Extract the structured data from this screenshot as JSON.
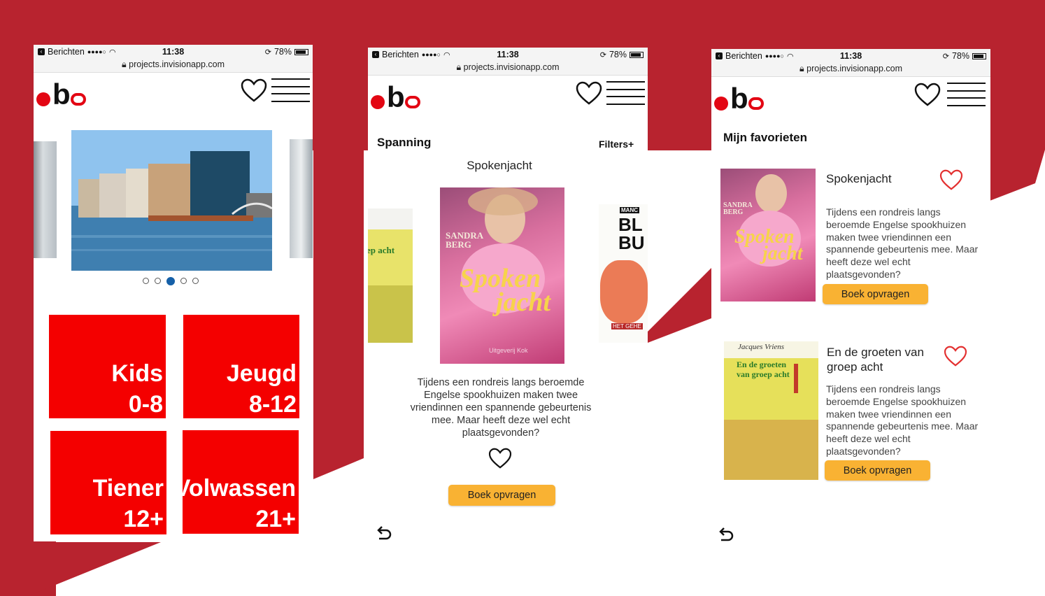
{
  "colors": {
    "background_red": "#b8232f",
    "tile_red": "#f40000",
    "accent_yellow": "#f9b233",
    "dot_active": "#1560a8",
    "heart_red": "#e33030"
  },
  "status_bar": {
    "carrier": "Berichten",
    "signal": "●●●●○",
    "time": "11:38",
    "battery": "78%"
  },
  "url": "projects.invisionapp.com",
  "logo": {
    "text": "ob"
  },
  "screen1": {
    "carousel_page": 3,
    "carousel_total": 5,
    "tiles": [
      {
        "line1": "Kids",
        "line2": "0-8"
      },
      {
        "line1": "Jeugd",
        "line2": "8-12"
      },
      {
        "line1": "Tiener",
        "line2": "12+"
      },
      {
        "line1": "Volwassen",
        "line2": "21+"
      }
    ]
  },
  "screen2": {
    "genre": "Spanning",
    "filters": "Filters+",
    "book_title": "Spokenjacht",
    "cover_author": "SANDRA BERG",
    "cover_title_line1": "Spoken",
    "cover_title_line2": "jacht",
    "cover_publisher": "Uitgeverij Kok",
    "left_cover_text": "ep acht",
    "right_cover_text1": "MANC",
    "right_cover_text2": "BL BU",
    "right_cover_text3": "HET GEHE",
    "description": "Tijdens een rondreis langs beroemde Engelse spookhuizen maken twee vriendinnen een spannende gebeurtenis mee. Maar heeft deze wel echt plaatsgevonden?",
    "button": "Boek opvragen"
  },
  "screen3": {
    "heading": "Mijn favorieten",
    "items": [
      {
        "title": "Spokenjacht",
        "cover_author": "SANDRA BERG",
        "cover_title_line1": "Spoken",
        "cover_title_line2": "jacht",
        "description": "Tijdens een rondreis langs beroemde Engelse spookhuizen maken twee vriendinnen een spannende gebeurtenis mee. Maar heeft deze wel echt plaatsgevonden?",
        "button": "Boek opvragen"
      },
      {
        "title": "En de groeten van groep acht",
        "cover_author": "Jacques Vriens",
        "cover_title": "En de groeten van groep acht",
        "description": "Tijdens een rondreis langs beroemde Engelse spookhuizen maken twee vriendinnen een spannende gebeurtenis mee. Maar heeft deze wel echt plaatsgevonden?",
        "button": "Boek opvragen"
      }
    ]
  }
}
